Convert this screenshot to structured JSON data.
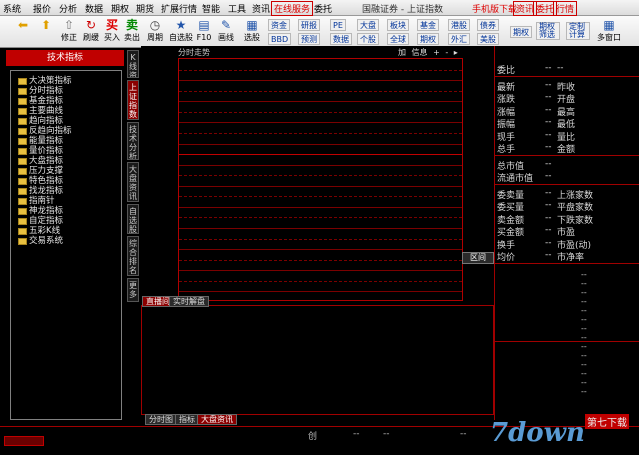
{
  "menu": {
    "items": [
      "系统",
      "报价",
      "分析",
      "数据",
      "期权",
      "期货",
      "扩展行情",
      "智能",
      "工具",
      "资讯"
    ],
    "online_service": "在线服务",
    "entrust": "委托",
    "window_title": "国融证券 - 上证指数",
    "right_items": [
      "手机版下载",
      "资讯",
      "委托",
      "行情"
    ]
  },
  "toolbar": {
    "buttons": [
      {
        "label": "修正",
        "icon": "⇧"
      },
      {
        "label": "刷缓",
        "icon": "↻"
      },
      {
        "label": "买入",
        "icon": "买"
      },
      {
        "label": "卖出",
        "icon": "卖"
      },
      {
        "label": "周期",
        "icon": "◷"
      },
      {
        "label": "自选股",
        "icon": "★"
      },
      {
        "label": "F10",
        "icon": "▤"
      },
      {
        "label": "画线",
        "icon": "✎"
      },
      {
        "label": "选股",
        "icon": "▦"
      }
    ],
    "small": {
      "zijin": "资金",
      "bbd": "BBD",
      "yanbao": "研报",
      "yuce": "预测",
      "pe": "PE",
      "shuju": "数据",
      "dapan": "大盘",
      "gegu": "个股",
      "bankuai": "板块",
      "quanqiu": "全球",
      "jijin": "基金",
      "qiquan": "期权",
      "ganggu": "港股",
      "waihui": "外汇",
      "zhaiquan": "债券",
      "meigu": "美股",
      "quanli": "期权",
      "qiquan_saixuan": "期权筛选",
      "dingzhi": "定制计算",
      "duomian": "多窗口"
    }
  },
  "left": {
    "header": "技术指标",
    "tree": [
      "大决策指标",
      "分时指标",
      "基金指标",
      "主要曲线",
      "趋向指标",
      "反趋向指标",
      "能量指标",
      "量价指标",
      "大盘指标",
      "压力支撑",
      "特色指标",
      "找龙指标",
      "指南针",
      "神龙指标",
      "自定指标",
      "五彩K线",
      "交易系统"
    ]
  },
  "vtabs": [
    "K线资讯",
    "上证指数",
    "技术分析",
    "大盘资讯",
    "自选股",
    "综合排名",
    "更多"
  ],
  "chart": {
    "title": "分时走势",
    "tools": [
      "加",
      "信息",
      "+",
      "-",
      "▸"
    ]
  },
  "quote_button": "区间",
  "bottom_tabs_top": [
    "直播间",
    "实时解盘"
  ],
  "bottom_tabs": [
    "分时图",
    "指标",
    "大盘资讯"
  ],
  "right": {
    "rows": [
      {
        "l": "委比",
        "r": "--"
      },
      {
        "l": "最新",
        "r": "昨收"
      },
      {
        "l": "涨跌",
        "r": "开盘"
      },
      {
        "l": "涨幅",
        "r": "最高"
      },
      {
        "l": "振幅",
        "r": "最低"
      },
      {
        "l": "现手",
        "r": "量比"
      },
      {
        "l": "总手",
        "r": "金额"
      }
    ],
    "rows2": [
      {
        "l": "总市值",
        "r": ""
      },
      {
        "l": "流通市值",
        "r": ""
      }
    ],
    "rows3": [
      {
        "l": "委卖量",
        "r": "上涨家数"
      },
      {
        "l": "委买量",
        "r": "平盘家数"
      },
      {
        "l": "卖金额",
        "r": "下跌家数"
      },
      {
        "l": "买金额",
        "r": "市盈"
      },
      {
        "l": "换手",
        "r": "市盈(动)"
      },
      {
        "l": "均价",
        "r": "市净率"
      }
    ],
    "dash": "--"
  },
  "status": {
    "c1": "创",
    "c2": "--",
    "c3": "--",
    "c4": "--"
  },
  "watermark": {
    "text": "7down",
    "tag": "第七下载"
  }
}
